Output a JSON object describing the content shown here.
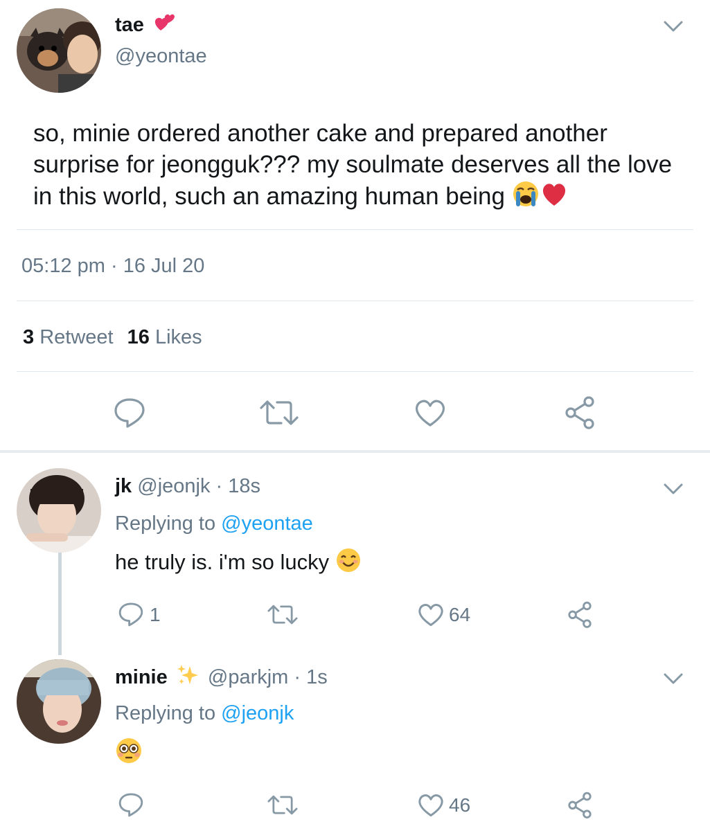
{
  "main_tweet": {
    "display_name": "tae",
    "name_emoji": "💞",
    "handle": "@yeontae",
    "text": "so, minie ordered another cake and prepared another surprise for jeongguk??? my soulmate deserves all the love in this world, such an amazing human being",
    "text_emojis": "😭❤️",
    "time": "05:12 pm",
    "separator": "·",
    "date": "16 Jul 20",
    "retweet_count": "3",
    "retweet_label": "Retweet",
    "like_count": "16",
    "like_label": "Likes",
    "actions": [
      "reply-icon",
      "retweet-icon",
      "like-icon",
      "share-icon"
    ]
  },
  "replies": [
    {
      "display_name": "jk",
      "handle": "@jeonjk",
      "sep": "·",
      "time": "18s",
      "replying_label": "Replying to",
      "replying_to": "@yeontae",
      "text": "he truly is. i'm so lucky",
      "emoji": "😊",
      "reply_count": "1",
      "retweet_count": "",
      "like_count": "64"
    },
    {
      "display_name": "minie",
      "name_emoji": "✨",
      "handle": "@parkjm",
      "sep": "·",
      "time": "1s",
      "replying_label": "Replying to",
      "replying_to": "@jeonjk",
      "text": "",
      "emoji": "😳",
      "reply_count": "",
      "retweet_count": "",
      "like_count": "46"
    }
  ],
  "colors": {
    "accent": "#1da1f2",
    "secondary_text": "#657786",
    "icon_grey": "#8899a6",
    "divider": "#e1e8ed",
    "thread_line": "#ccd6dd"
  }
}
